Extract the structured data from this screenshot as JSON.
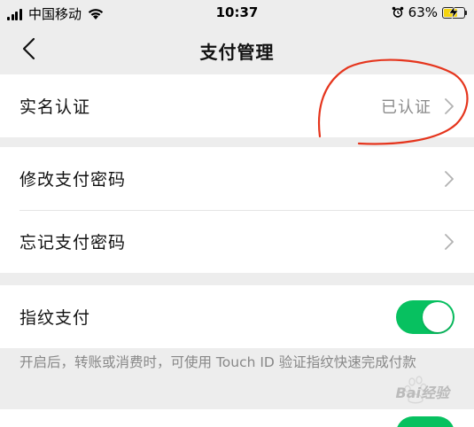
{
  "status_bar": {
    "carrier": "中国移动",
    "time": "10:37",
    "battery": "63%",
    "battery_level": 0.63
  },
  "nav": {
    "title": "支付管理",
    "back_icon": "chevron-left-icon"
  },
  "rows": {
    "real_name": {
      "label": "实名认证",
      "value": "已认证"
    },
    "change_password": {
      "label": "修改支付密码"
    },
    "forgot_password": {
      "label": "忘记支付密码"
    },
    "fingerprint": {
      "label": "指纹支付",
      "enabled": true
    }
  },
  "fingerprint_desc": "开启后，转账或消费时，可使用 Touch ID 验证指纹快速完成付款",
  "watermark": "Bai经验",
  "colors": {
    "background": "#ededed",
    "toggle_on": "#07c160",
    "annotation": "#e5351d",
    "secondary_text": "#8a8a8a"
  }
}
